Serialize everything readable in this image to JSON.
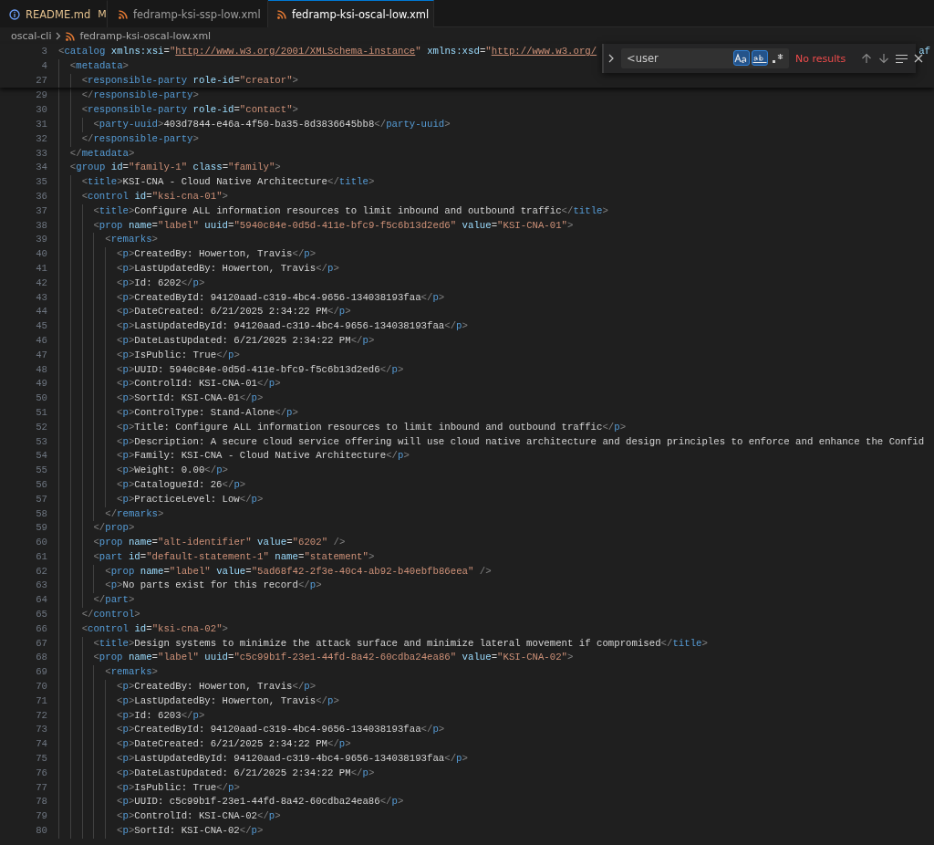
{
  "tabs": [
    {
      "label": "README.md",
      "kind": "info",
      "badge": "M",
      "modified": true,
      "selected": false
    },
    {
      "label": "fedramp-ksi-ssp-low.xml",
      "kind": "xml",
      "modified": false,
      "selected": false
    },
    {
      "label": "fedramp-ksi-oscal-low.xml",
      "kind": "xml",
      "modified": false,
      "selected": true
    }
  ],
  "breadcrumb": [
    "oscal-cli",
    "fedramp-ksi-oscal-low.xml"
  ],
  "find": {
    "value": "<user",
    "match_case": true,
    "whole_word": true,
    "regex": false,
    "status": "No results"
  },
  "sticky_lines": [
    {
      "number": "3",
      "text": "<catalog xmlns:xsi=\"http://www.w3.org/2001/XMLSchema-instance\" xmlns:xsd=\"http://www.w3.org/",
      "tail": "af"
    },
    {
      "number": "4",
      "text": "  <metadata>"
    },
    {
      "number": "27",
      "text": "    <responsible-party role-id=\"creator\">"
    }
  ],
  "lines": [
    {
      "number": "29",
      "text": "    </responsible-party>"
    },
    {
      "number": "30",
      "text": "    <responsible-party role-id=\"contact\">"
    },
    {
      "number": "31",
      "text": "      <party-uuid>403d7844-e46a-4f50-ba35-8d3836645bb8</party-uuid>"
    },
    {
      "number": "32",
      "text": "    </responsible-party>"
    },
    {
      "number": "33",
      "text": "  </metadata>"
    },
    {
      "number": "34",
      "text": "  <group id=\"family-1\" class=\"family\">"
    },
    {
      "number": "35",
      "text": "    <title>KSI-CNA - Cloud Native Architecture</title>"
    },
    {
      "number": "36",
      "text": "    <control id=\"ksi-cna-01\">"
    },
    {
      "number": "37",
      "text": "      <title>Configure ALL information resources to limit inbound and outbound traffic</title>"
    },
    {
      "number": "38",
      "text": "      <prop name=\"label\" uuid=\"5940c84e-0d5d-411e-bfc9-f5c6b13d2ed6\" value=\"KSI-CNA-01\">"
    },
    {
      "number": "39",
      "text": "        <remarks>"
    },
    {
      "number": "40",
      "text": "          <p>CreatedBy: Howerton, Travis</p>"
    },
    {
      "number": "41",
      "text": "          <p>LastUpdatedBy: Howerton, Travis</p>"
    },
    {
      "number": "42",
      "text": "          <p>Id: 6202</p>"
    },
    {
      "number": "43",
      "text": "          <p>CreatedById: 94120aad-c319-4bc4-9656-134038193faa</p>"
    },
    {
      "number": "44",
      "text": "          <p>DateCreated: 6/21/2025 2:34:22 PM</p>"
    },
    {
      "number": "45",
      "text": "          <p>LastUpdatedById: 94120aad-c319-4bc4-9656-134038193faa</p>"
    },
    {
      "number": "46",
      "text": "          <p>DateLastUpdated: 6/21/2025 2:34:22 PM</p>"
    },
    {
      "number": "47",
      "text": "          <p>IsPublic: True</p>"
    },
    {
      "number": "48",
      "text": "          <p>UUID: 5940c84e-0d5d-411e-bfc9-f5c6b13d2ed6</p>"
    },
    {
      "number": "49",
      "text": "          <p>ControlId: KSI-CNA-01</p>"
    },
    {
      "number": "50",
      "text": "          <p>SortId: KSI-CNA-01</p>"
    },
    {
      "number": "51",
      "text": "          <p>ControlType: Stand-Alone</p>"
    },
    {
      "number": "52",
      "text": "          <p>Title: Configure ALL information resources to limit inbound and outbound traffic</p>"
    },
    {
      "number": "53",
      "text": "          <p>Description: A secure cloud service offering will use cloud native architecture and design principles to enforce and enhance the Confid"
    },
    {
      "number": "54",
      "text": "          <p>Family: KSI-CNA - Cloud Native Architecture</p>"
    },
    {
      "number": "55",
      "text": "          <p>Weight: 0.00</p>"
    },
    {
      "number": "56",
      "text": "          <p>CatalogueId: 26</p>"
    },
    {
      "number": "57",
      "text": "          <p>PracticeLevel: Low</p>"
    },
    {
      "number": "58",
      "text": "        </remarks>"
    },
    {
      "number": "59",
      "text": "      </prop>"
    },
    {
      "number": "60",
      "text": "      <prop name=\"alt-identifier\" value=\"6202\" />"
    },
    {
      "number": "61",
      "text": "      <part id=\"default-statement-1\" name=\"statement\">"
    },
    {
      "number": "62",
      "text": "        <prop name=\"label\" value=\"5ad68f42-2f3e-40c4-ab92-b40ebfb86eea\" />"
    },
    {
      "number": "63",
      "text": "        <p>No parts exist for this record</p>"
    },
    {
      "number": "64",
      "text": "      </part>"
    },
    {
      "number": "65",
      "text": "    </control>"
    },
    {
      "number": "66",
      "text": "    <control id=\"ksi-cna-02\">"
    },
    {
      "number": "67",
      "text": "      <title>Design systems to minimize the attack surface and minimize lateral movement if compromised</title>"
    },
    {
      "number": "68",
      "text": "      <prop name=\"label\" uuid=\"c5c99b1f-23e1-44fd-8a42-60cdba24ea86\" value=\"KSI-CNA-02\">"
    },
    {
      "number": "69",
      "text": "        <remarks>"
    },
    {
      "number": "70",
      "text": "          <p>CreatedBy: Howerton, Travis</p>"
    },
    {
      "number": "71",
      "text": "          <p>LastUpdatedBy: Howerton, Travis</p>"
    },
    {
      "number": "72",
      "text": "          <p>Id: 6203</p>"
    },
    {
      "number": "73",
      "text": "          <p>CreatedById: 94120aad-c319-4bc4-9656-134038193faa</p>"
    },
    {
      "number": "74",
      "text": "          <p>DateCreated: 6/21/2025 2:34:22 PM</p>"
    },
    {
      "number": "75",
      "text": "          <p>LastUpdatedById: 94120aad-c319-4bc4-9656-134038193faa</p>"
    },
    {
      "number": "76",
      "text": "          <p>DateLastUpdated: 6/21/2025 2:34:22 PM</p>"
    },
    {
      "number": "77",
      "text": "          <p>IsPublic: True</p>"
    },
    {
      "number": "78",
      "text": "          <p>UUID: c5c99b1f-23e1-44fd-8a42-60cdba24ea86</p>"
    },
    {
      "number": "79",
      "text": "          <p>ControlId: KSI-CNA-02</p>"
    },
    {
      "number": "80",
      "text": "          <p>SortId: KSI-CNA-02</p>"
    }
  ]
}
